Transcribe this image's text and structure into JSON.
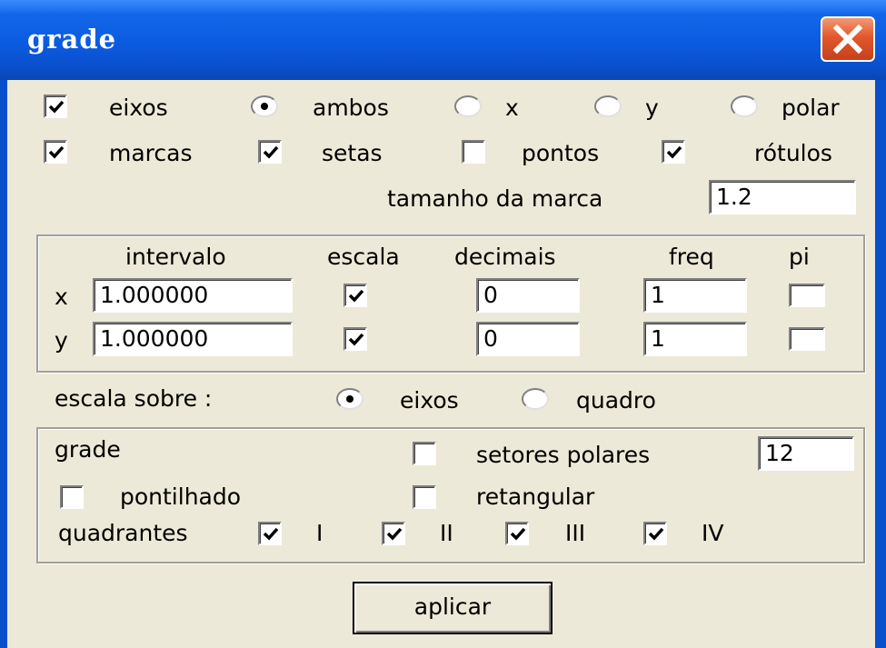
{
  "window": {
    "title": "grade",
    "close_icon": "close-icon"
  },
  "row1": {
    "eixos": {
      "label": "eixos",
      "checked": true
    },
    "radios": [
      {
        "label": "ambos",
        "selected": true
      },
      {
        "label": "x",
        "selected": false
      },
      {
        "label": "y",
        "selected": false
      },
      {
        "label": "polar",
        "selected": false
      }
    ]
  },
  "row2": {
    "marcas": {
      "label": "marcas",
      "checked": true
    },
    "setas": {
      "label": "setas",
      "checked": true
    },
    "pontos": {
      "label": "pontos",
      "checked": false
    },
    "rotulos": {
      "label": "rótulos",
      "checked": true
    }
  },
  "tick_size": {
    "label": "tamanho da marca",
    "value": "1.2"
  },
  "axes_table": {
    "headers": {
      "intervalo": "intervalo",
      "escala": "escala",
      "decimais": "decimais",
      "freq": "freq",
      "pi": "pi"
    },
    "rows": [
      {
        "axis": "x",
        "intervalo": "1.000000",
        "escala": true,
        "decimais": "0",
        "freq": "1",
        "pi": false
      },
      {
        "axis": "y",
        "intervalo": "1.000000",
        "escala": true,
        "decimais": "0",
        "freq": "1",
        "pi": false
      }
    ]
  },
  "scale_on": {
    "label": "escala sobre :",
    "options": [
      {
        "label": "eixos",
        "selected": true
      },
      {
        "label": "quadro",
        "selected": false
      }
    ]
  },
  "grid": {
    "label": "grade",
    "setores": {
      "label": "setores polares",
      "checked": false,
      "value": "12"
    },
    "pontilhado": {
      "label": "pontilhado",
      "checked": false
    },
    "retangular": {
      "label": "retangular",
      "checked": false
    },
    "quadrantes": {
      "label": "quadrantes",
      "items": [
        {
          "label": "I",
          "checked": true
        },
        {
          "label": "II",
          "checked": true
        },
        {
          "label": "III",
          "checked": true
        },
        {
          "label": "IV",
          "checked": true
        }
      ]
    }
  },
  "apply_button": {
    "label": "aplicar"
  }
}
